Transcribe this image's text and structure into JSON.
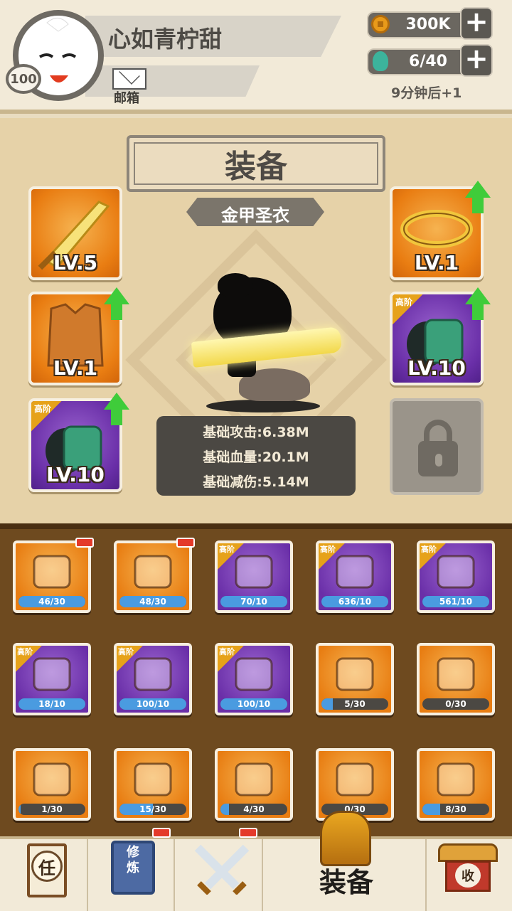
{
  "player": {
    "name": "心如青柠甜",
    "level": "100",
    "mail_label": "邮箱"
  },
  "resources": {
    "gold": "300K",
    "stamina": "6/40",
    "timer": "9分钟后+1"
  },
  "equip_panel": {
    "title": "装备",
    "subtitle": "金甲圣衣",
    "left_slots": [
      {
        "item": "golden-sword",
        "level": "LV.5",
        "tier": "",
        "upgradable": false
      },
      {
        "item": "leather-armor",
        "level": "LV.1",
        "tier": "",
        "upgradable": true
      },
      {
        "item": "jade-bracer",
        "level": "LV.10",
        "tier": "高阶",
        "upgradable": true
      }
    ],
    "right_slots": [
      {
        "item": "gold-ring",
        "level": "LV.1",
        "tier": "",
        "upgradable": true
      },
      {
        "item": "jade-bracer",
        "level": "LV.10",
        "tier": "高阶",
        "upgradable": true
      },
      {
        "item": "locked-slot",
        "level": "",
        "tier": "",
        "upgradable": false
      }
    ],
    "stats": [
      "基础攻击:6.38M",
      "基础血量:20.1M",
      "基础减伤:5.14M"
    ]
  },
  "inventory": {
    "items": [
      {
        "icon": "gold-ring",
        "rarity": "orange",
        "tier": "",
        "count": "46/30",
        "fill": 1.0,
        "badge": true
      },
      {
        "icon": "leather-armor",
        "rarity": "orange",
        "tier": "",
        "count": "48/30",
        "fill": 1.0,
        "badge": true
      },
      {
        "icon": "curved-blade",
        "rarity": "purple",
        "tier": "高阶",
        "count": "70/10",
        "fill": 1.0,
        "badge": false
      },
      {
        "icon": "wooden-sword",
        "rarity": "purple",
        "tier": "高阶",
        "count": "636/10",
        "fill": 1.0,
        "badge": false
      },
      {
        "icon": "spiked-gauntlet",
        "rarity": "purple",
        "tier": "高阶",
        "count": "561/10",
        "fill": 1.0,
        "badge": false
      },
      {
        "icon": "broad-saber",
        "rarity": "purple",
        "tier": "高阶",
        "count": "18/10",
        "fill": 1.0,
        "badge": false
      },
      {
        "icon": "straw-hat",
        "rarity": "purple",
        "tier": "高阶",
        "count": "100/10",
        "fill": 1.0,
        "badge": false
      },
      {
        "icon": "purple-armor",
        "rarity": "purple",
        "tier": "高阶",
        "count": "100/10",
        "fill": 1.0,
        "badge": false
      },
      {
        "icon": "trident-spear",
        "rarity": "orange",
        "tier": "",
        "count": "5/30",
        "fill": 0.17,
        "badge": false
      },
      {
        "icon": "war-hammer",
        "rarity": "orange",
        "tier": "",
        "count": "0/30",
        "fill": 0.0,
        "badge": false
      },
      {
        "icon": "black-staff",
        "rarity": "orange",
        "tier": "",
        "count": "1/30",
        "fill": 0.03,
        "badge": false
      },
      {
        "icon": "golden-sword",
        "rarity": "orange",
        "tier": "",
        "count": "15/30",
        "fill": 0.5,
        "badge": false
      },
      {
        "icon": "steel-sword",
        "rarity": "orange",
        "tier": "",
        "count": "4/30",
        "fill": 0.13,
        "badge": false
      },
      {
        "icon": "bamboo-hat",
        "rarity": "orange",
        "tier": "",
        "count": "0/30",
        "fill": 0.0,
        "badge": false
      },
      {
        "icon": "hooded-cloak",
        "rarity": "orange",
        "tier": "",
        "count": "8/30",
        "fill": 0.27,
        "badge": false
      }
    ]
  },
  "nav": {
    "task_char": "任",
    "cultivate_text": "修炼",
    "equip_label": "装备",
    "shop_char": "收"
  },
  "colors": {
    "orange_bg": "#e97d12",
    "purple_bg": "#6a2fa8",
    "upgrade_arrow": "#3fcc3a",
    "progress_fill": "#4a9be0",
    "badge_red": "#e43a2a"
  }
}
